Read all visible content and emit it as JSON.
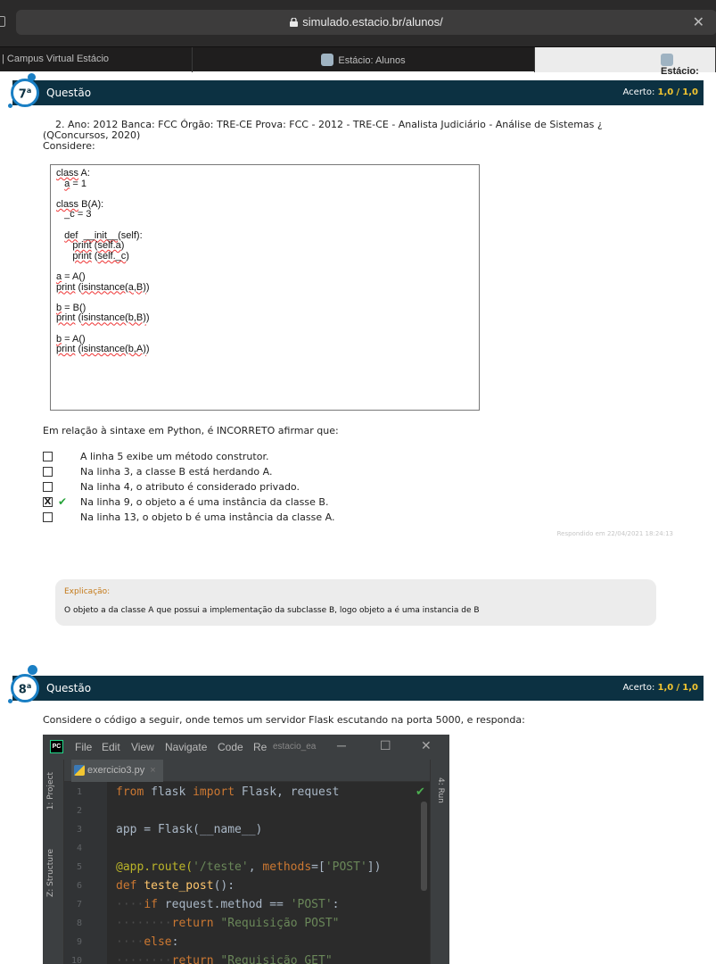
{
  "browser": {
    "url": "simulado.estacio.br/alunos/",
    "tabs": [
      {
        "label": "| Campus Virtual Estácio"
      },
      {
        "label": "Estácio: Alunos"
      },
      {
        "label": "Estácio:"
      }
    ]
  },
  "question7": {
    "number": "7",
    "ordinal": "a",
    "label": "Questão",
    "acerto_label": "Acerto:",
    "acerto_value": "1,0",
    "acerto_sep": "/",
    "acerto_max": "1,0",
    "header_line": "2. Ano: 2012 Banca: FCC Órgão: TRE-CE Prova: FCC - 2012 - TRE-CE - Analista Judiciário - Análise de Sistemas ¿",
    "header_line2": "(QConcursos, 2020)",
    "consider": "Considere:",
    "code_lines": [
      "class A:",
      "   a = 1",
      "",
      "class B(A):",
      "   _c = 3",
      "",
      "   def __init__(self):",
      "      print (self.a)",
      "      print (self._c)",
      "",
      "a = A()",
      "print (isinstance(a,B))",
      "",
      "b = B()",
      "print (isinstance(b,B))",
      "",
      "b = A()",
      "print (isinstance(b,A))"
    ],
    "prompt": "Em relação à sintaxe em Python, é INCORRETO afirmar que:",
    "options": [
      {
        "text": "A linha 5 exibe um método construtor.",
        "marked": false
      },
      {
        "text": "Na linha 3, a classe B está herdando A.",
        "marked": false
      },
      {
        "text": "Na linha 4, o atributo é considerado privado.",
        "marked": false
      },
      {
        "text": "Na linha 9, o objeto a é uma instância da classe B.",
        "marked": true
      },
      {
        "text": "Na linha 13, o objeto b é uma instância da classe A.",
        "marked": false
      }
    ],
    "answered": "Respondido em 22/04/2021 18:24:13",
    "explanation_title": "Explicação:",
    "explanation_body": "O objeto a da classe A que possui a implementação da subclasse B, logo objeto a é uma instancia de B"
  },
  "question8": {
    "number": "8",
    "ordinal": "a",
    "label": "Questão",
    "acerto_label": "Acerto:",
    "acerto_value": "1,0",
    "acerto_sep": "/",
    "acerto_max": "1,0",
    "intro": "Considere o código a seguir, onde temos um servidor Flask escutando na porta 5000, e responda:"
  },
  "ide": {
    "logo": "PC",
    "menu": [
      "File",
      "Edit",
      "View",
      "Navigate",
      "Code",
      "Re"
    ],
    "project_name": "estacio_ea",
    "left_tabs": [
      "1: Project",
      "Z: Structure"
    ],
    "right_tab": "4: Run",
    "file_tab": "exercicio3.py",
    "line_numbers": [
      "1",
      "2",
      "3",
      "4",
      "5",
      "6",
      "7",
      "8",
      "9",
      "10"
    ]
  },
  "colors": {
    "header_bg": "#0c3142",
    "acerto_value": "#f4c630",
    "badge_ring": "#1a7fc4",
    "correct_check": "#27a33a",
    "explanation_title": "#c47a1a"
  }
}
